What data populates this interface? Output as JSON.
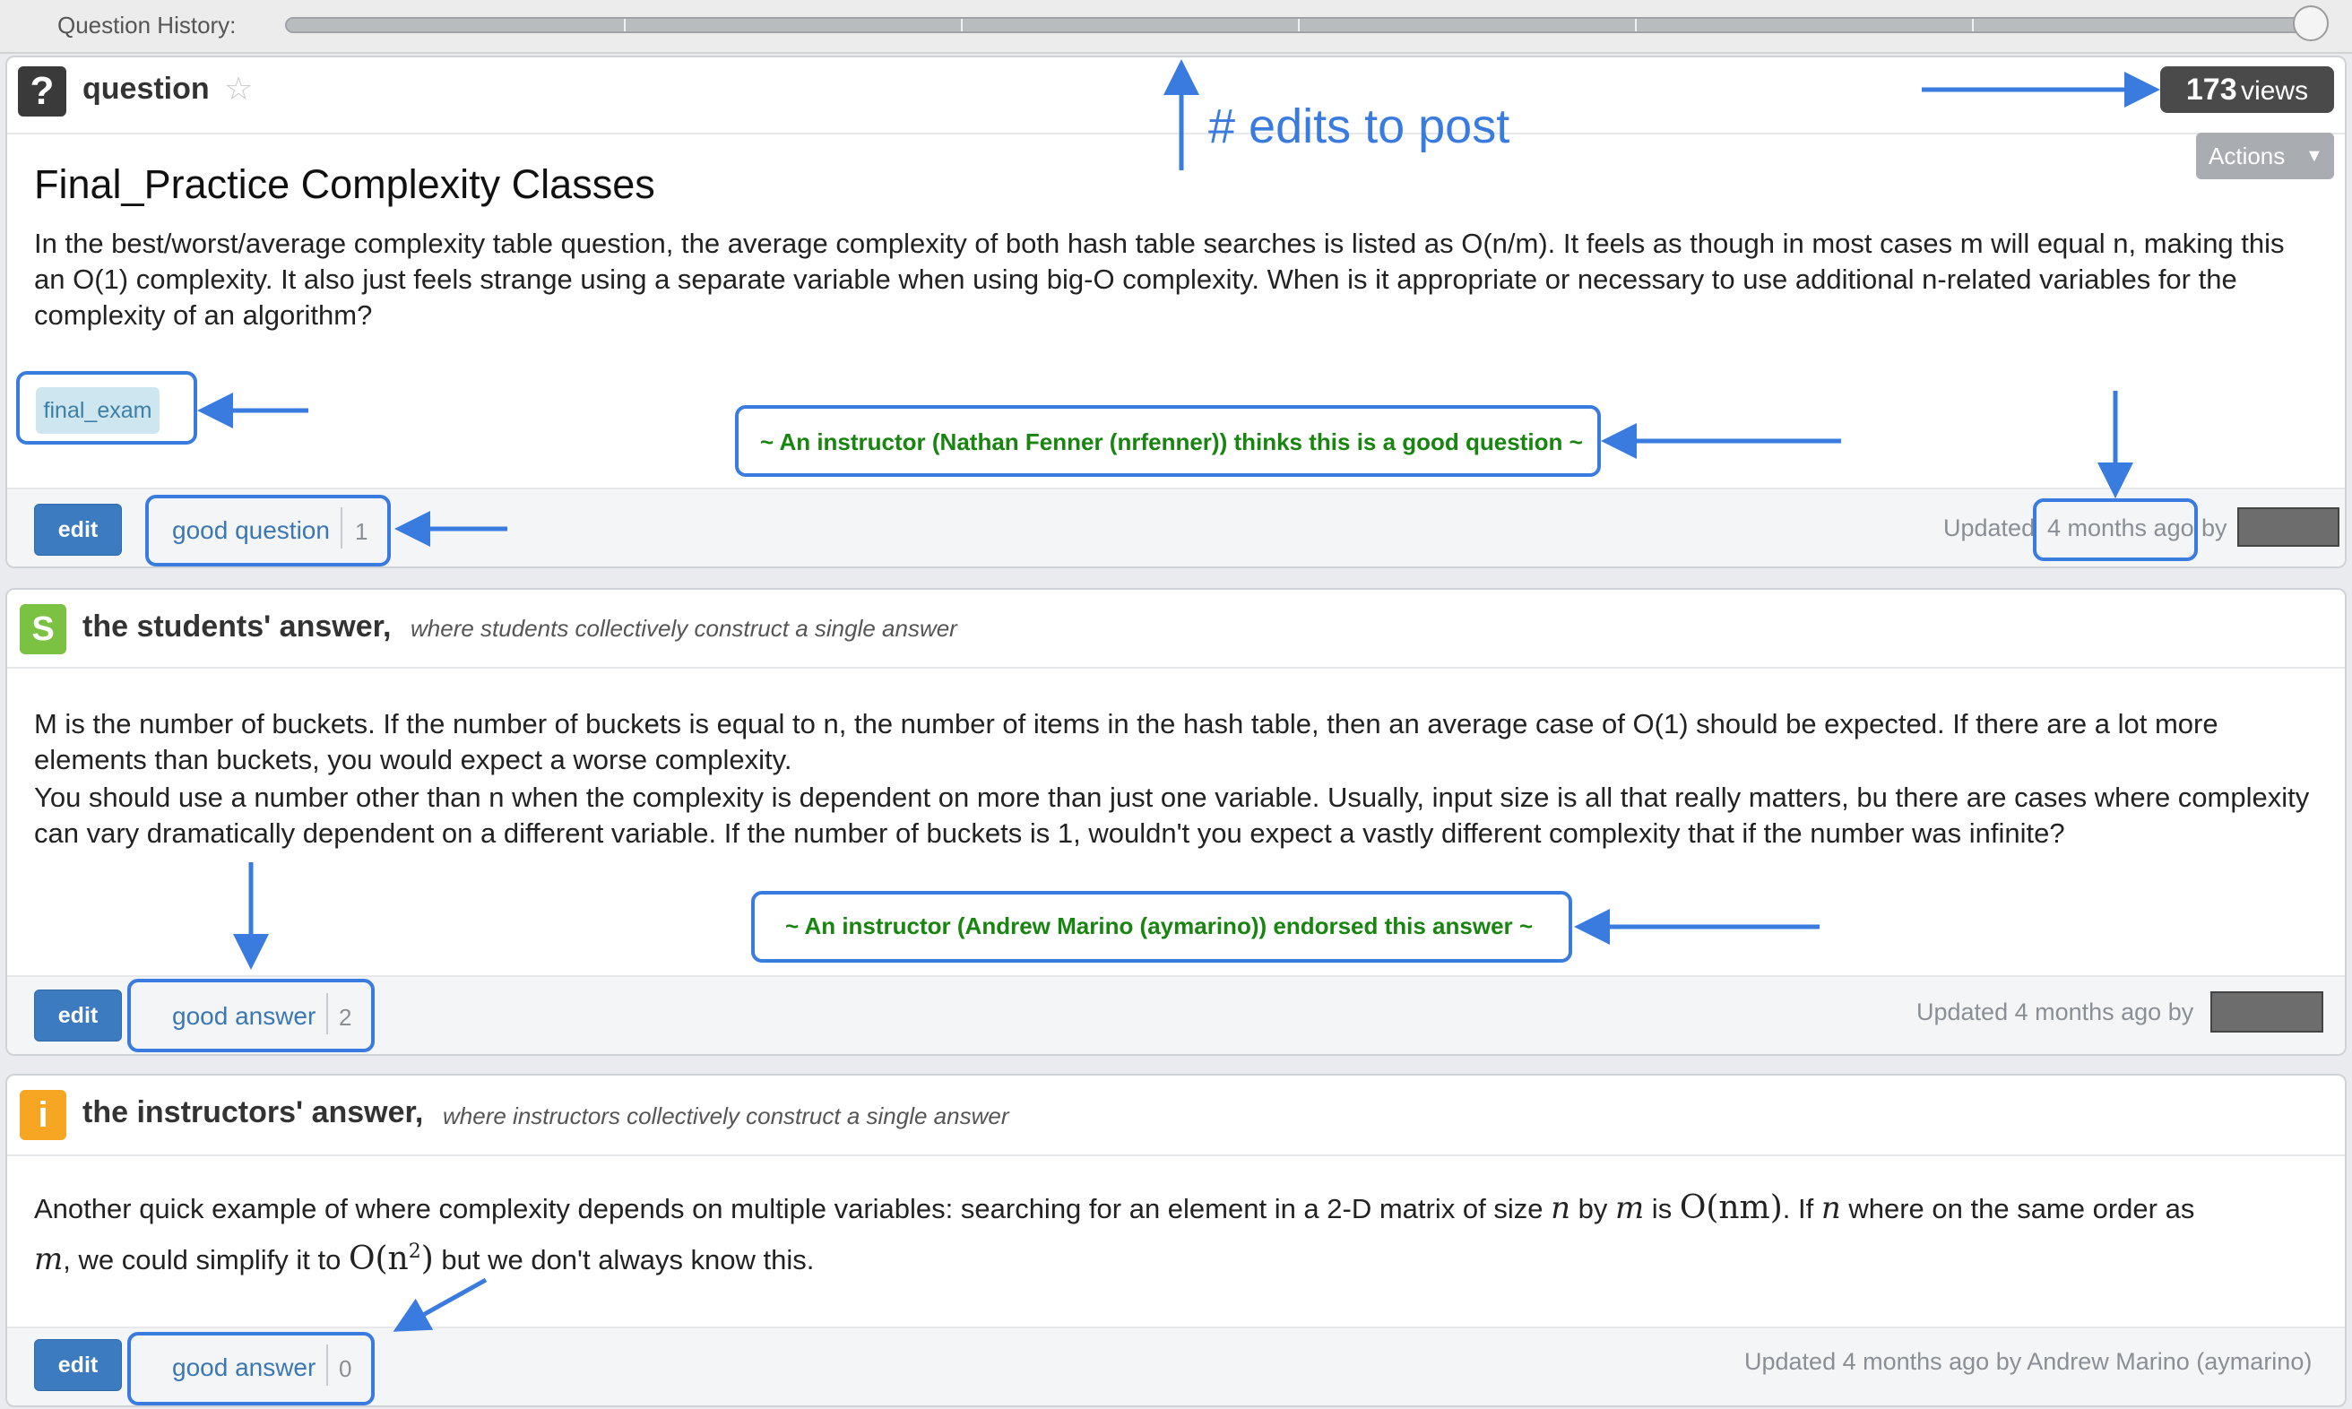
{
  "history": {
    "label": "Question History:"
  },
  "question": {
    "header_label": "question",
    "views_count": "173",
    "views_label": "views",
    "actions_label": "Actions",
    "title": "Final_Practice Complexity Classes",
    "body": "In the best/worst/average complexity table question, the average complexity of both hash table searches is listed as O(n/m). It feels as though in most cases m will equal n, making this an O(1) complexity. It also just feels strange using a separate variable when using big-O complexity. When is it appropriate or necessary to use additional n-related variables for the complexity of an algorithm?",
    "tag": "final_exam",
    "endorsement": "~ An instructor (Nathan Fenner (nrfenner)) thinks this is a good question ~",
    "edit_label": "edit",
    "good_label": "good question",
    "good_count": "1",
    "updated_prefix": "Updated",
    "updated_time": "4 months ago",
    "updated_by": "by"
  },
  "students_answer": {
    "badge": "S",
    "title": "the students' answer,",
    "subtitle": "where students collectively construct a single answer",
    "para1": "M is the number of buckets. If the number of buckets is equal to n, the number of items in the hash table, then an average case of O(1) should be expected. If there are a lot more elements than buckets, you would expect a worse complexity.",
    "para2": "You should use a number other than n when the complexity is dependent on more than just one variable. Usually, input size is all that really matters, bu there are cases where complexity can vary dramatically dependent on a different variable. If the number of buckets is 1, wouldn't you expect a vastly different complexity that if the number was infinite?",
    "endorsement": "~ An instructor (Andrew Marino (aymarino)) endorsed this answer ~",
    "edit_label": "edit",
    "good_label": "good answer",
    "good_count": "2",
    "updated": "Updated 4 months ago by"
  },
  "instructors_answer": {
    "badge": "i",
    "title": "the instructors' answer,",
    "subtitle": "where instructors collectively construct a single answer",
    "line1_a": "Another quick example of where complexity depends on multiple variables: searching for an element in a 2-D matrix of size ",
    "var_n": "n",
    "line1_by": " by ",
    "var_m": "m",
    "line1_is": " is ",
    "expr_onm": "O(nm)",
    "line1_if": ". If ",
    "line1_where": " where on the same order as",
    "line2_b": ", we could simplify it to ",
    "expr_on2_base": "O(n",
    "expr_on2_exp": "2",
    "expr_on2_close": ")",
    "line2_c": " but we don't always know this.",
    "edit_label": "edit",
    "good_label": "good answer",
    "good_count": "0",
    "updated": "Updated 4 months ago by Andrew Marino (aymarino)"
  },
  "annotations": {
    "edits_label": "# edits to post"
  },
  "colors": {
    "annotation": "#3a7be0",
    "edit_button": "#3c7bbf",
    "endorse_green": "#17850f",
    "students_badge": "#7cc242",
    "instructors_badge": "#f6a623"
  }
}
